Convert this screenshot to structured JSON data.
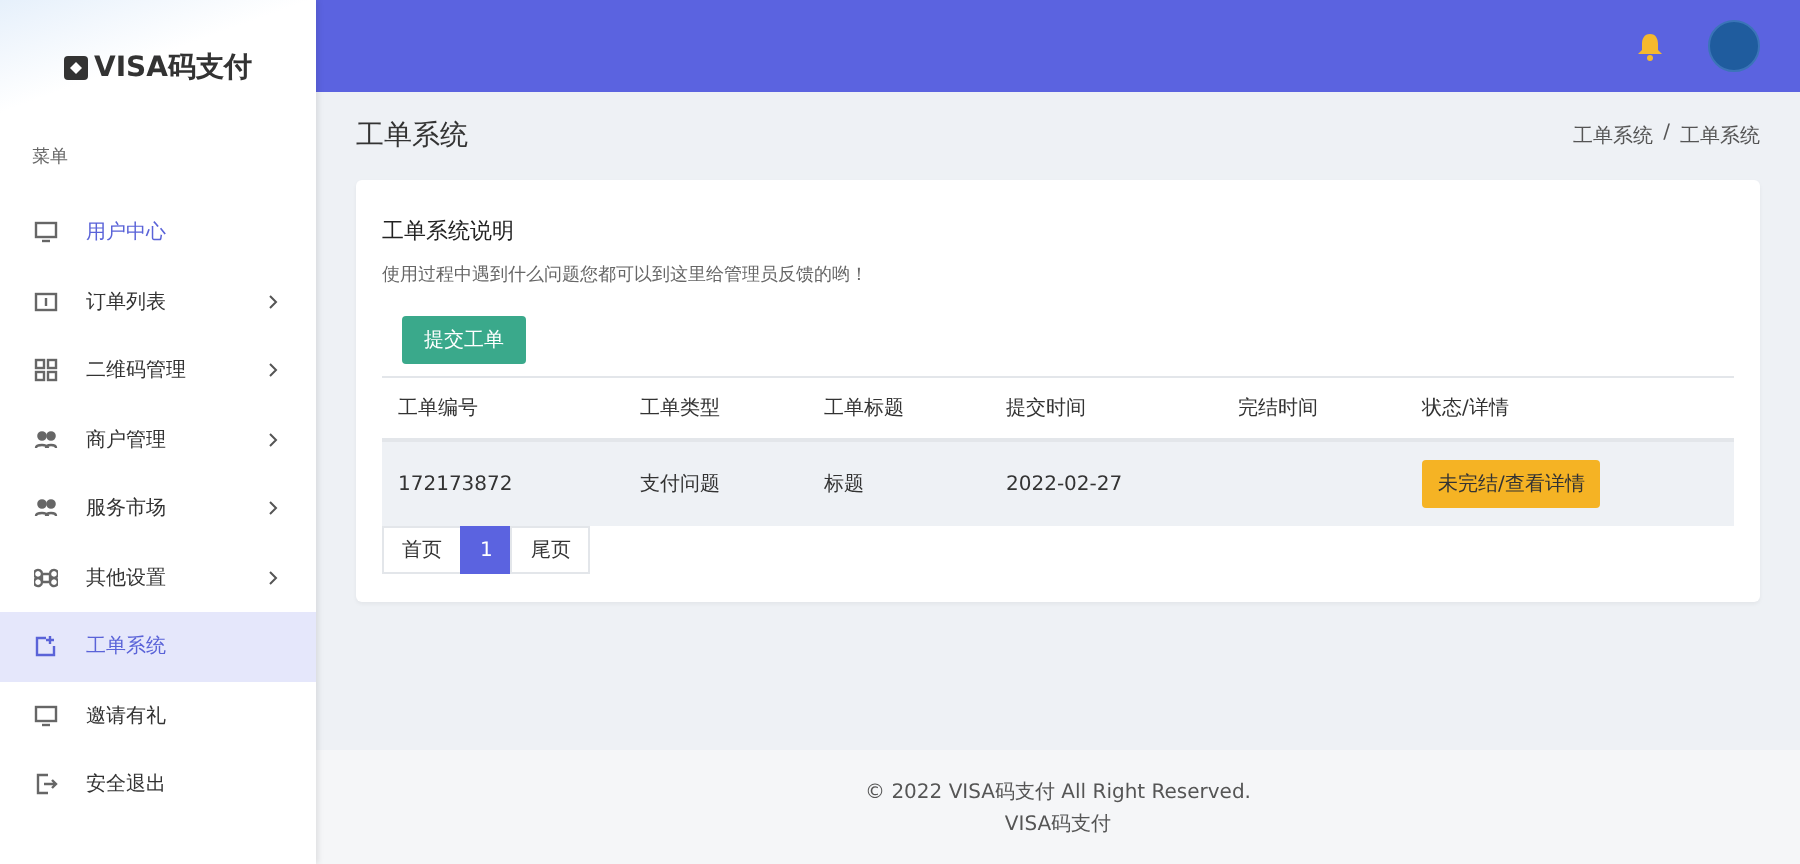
{
  "brand": "VISA码支付",
  "sidebar": {
    "section": "菜单",
    "items": [
      {
        "label": "用户中心",
        "kind": "monitor",
        "has_arrow": false,
        "selected": false,
        "emphasized": true
      },
      {
        "label": "订单列表",
        "kind": "card",
        "has_arrow": true,
        "selected": false,
        "emphasized": false
      },
      {
        "label": "二维码管理",
        "kind": "qr",
        "has_arrow": true,
        "selected": false,
        "emphasized": false
      },
      {
        "label": "商户管理",
        "kind": "users",
        "has_arrow": true,
        "selected": false,
        "emphasized": false
      },
      {
        "label": "服务市场",
        "kind": "users",
        "has_arrow": true,
        "selected": false,
        "emphasized": false
      },
      {
        "label": "其他设置",
        "kind": "command",
        "has_arrow": true,
        "selected": false,
        "emphasized": false
      },
      {
        "label": "工单系统",
        "kind": "share",
        "has_arrow": false,
        "selected": true,
        "emphasized": false
      },
      {
        "label": "邀请有礼",
        "kind": "monitor",
        "has_arrow": false,
        "selected": false,
        "emphasized": false
      },
      {
        "label": "安全退出",
        "kind": "exit",
        "has_arrow": false,
        "selected": false,
        "emphasized": false
      }
    ]
  },
  "page_title": "工单系统",
  "breadcrumb": [
    "工单系统",
    "工单系统"
  ],
  "breadcrumb_separator": "/",
  "card": {
    "title": "工单系统说明",
    "description": "使用过程中遇到什么问题您都可以到这里给管理员反馈的哟！",
    "submit_button": "提交工单",
    "table": {
      "columns": [
        "工单编号",
        "工单类型",
        "工单标题",
        "提交时间",
        "完结时间",
        "状态/详情"
      ],
      "rows": [
        {
          "cells": [
            "172173872",
            "支付问题",
            "标题",
            "2022-02-27",
            ""
          ],
          "status_button": "未完结/查看详情"
        }
      ]
    },
    "pagination": [
      {
        "label": "首页",
        "selected": false
      },
      {
        "label": "1",
        "selected": true
      },
      {
        "label": "尾页",
        "selected": false
      }
    ]
  },
  "footer": {
    "copyright": "© 2022 VISA码支付 All Right Reserved.",
    "brand": "VISA码支付"
  }
}
